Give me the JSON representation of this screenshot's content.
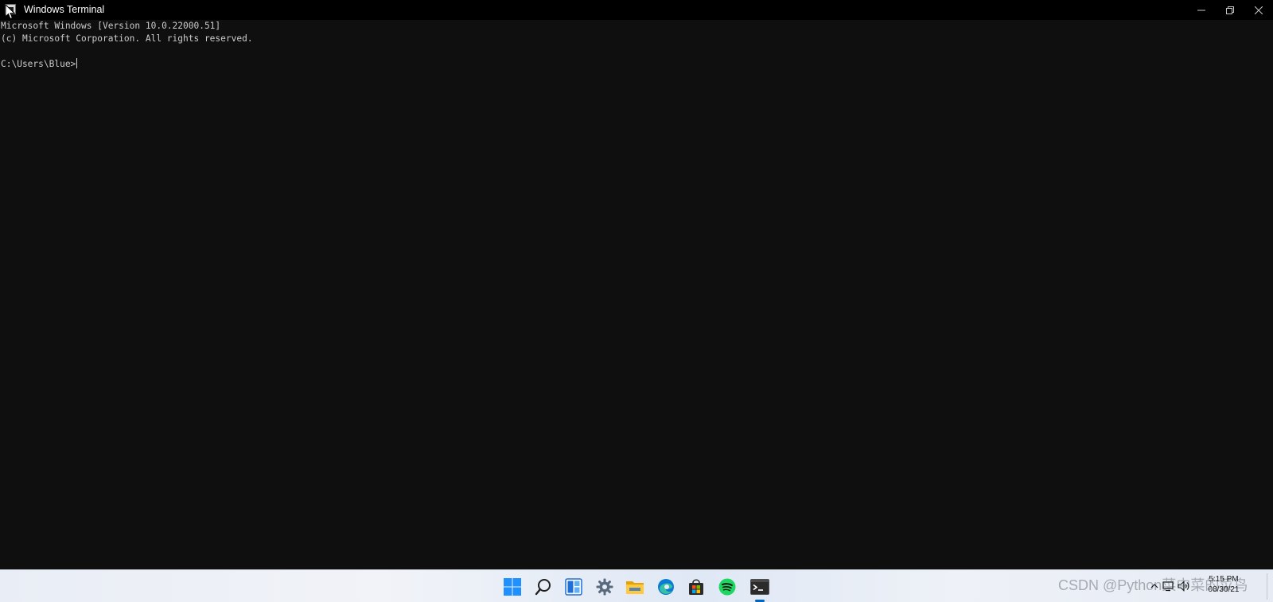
{
  "window": {
    "title": "Windows Terminal",
    "icon": "terminal-app-icon",
    "controls": {
      "minimize_icon": "minimize-icon",
      "maximize_icon": "restore-icon",
      "close_icon": "close-icon"
    }
  },
  "terminal": {
    "lines": [
      "Microsoft Windows [Version 10.0.22000.51]",
      "(c) Microsoft Corporation. All rights reserved.",
      "",
      "C:\\Users\\Blue>"
    ],
    "background": "#0f0f0f",
    "foreground": "#cccccc"
  },
  "taskbar": {
    "pinned": [
      {
        "name": "start-button",
        "icon": "windows-logo-icon"
      },
      {
        "name": "search-button",
        "icon": "search-icon"
      },
      {
        "name": "widgets-button",
        "icon": "widgets-icon"
      },
      {
        "name": "settings-button",
        "icon": "gear-icon"
      },
      {
        "name": "file-explorer-button",
        "icon": "folder-icon"
      },
      {
        "name": "edge-button",
        "icon": "edge-icon"
      },
      {
        "name": "store-button",
        "icon": "store-icon"
      },
      {
        "name": "spotify-button",
        "icon": "spotify-icon"
      },
      {
        "name": "terminal-button",
        "icon": "terminal-icon",
        "active": true
      }
    ],
    "tray": {
      "watermark": "CSDN @Python菜中菜的菜鸟",
      "clock_time": "5:15 PM",
      "clock_date": "08/30/21"
    },
    "accent": "#0067c0"
  }
}
